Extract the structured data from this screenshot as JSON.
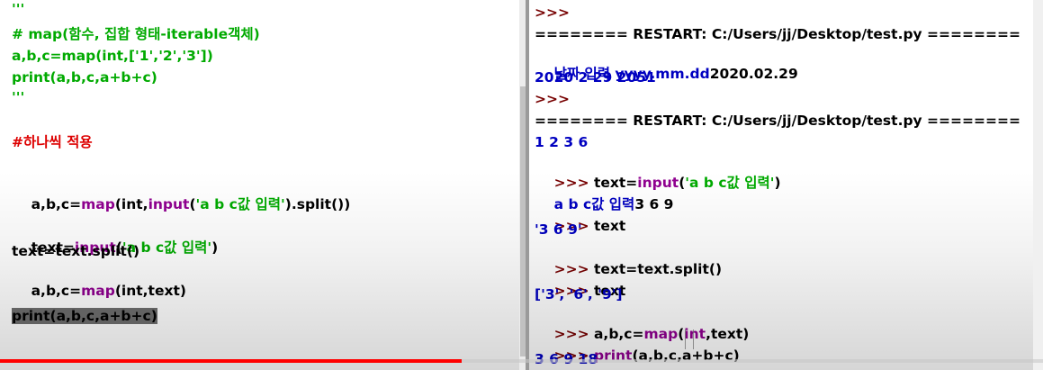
{
  "editor": {
    "lines": [
      {
        "text": "'''",
        "color": "green"
      },
      {
        "text": "# map(함수, 집합 형태-iterable객체)",
        "color": "green"
      },
      {
        "text": "a,b,c=map(int,['1','2','3'])",
        "color": "green"
      },
      {
        "text": "print(a,b,c,a+b+c)",
        "color": "green"
      },
      {
        "text": "'''",
        "color": "green"
      },
      {
        "text": "#하나씩 적용",
        "color": "red"
      },
      {
        "seg": [
          "a,b,c=",
          "map",
          "(int,",
          "input",
          "(",
          "'a b c값 입력'",
          ").split())"
        ]
      },
      {
        "seg": [
          "text=",
          "input",
          "(",
          "'a b c값 입력'",
          ")"
        ]
      },
      {
        "text": "text=text.split()",
        "color": "black"
      },
      {
        "seg": [
          "a,b,c=",
          "map",
          "(int,text)"
        ]
      },
      {
        "text": "print(a,b,c,a+b+c)",
        "color": "black",
        "highlight": true
      }
    ]
  },
  "shell": {
    "prompt": ">>>",
    "restart_line": "======== RESTART: C:/Users/jj/Desktop/test.py ========",
    "date_prompt": "날짜 입력 yyyy.mm.dd",
    "date_input": "2020.02.29",
    "date_output": "2020 2 29 2051",
    "output_1236": "1 2 3 6",
    "cmd_input_seg": [
      "text=",
      "input",
      "(",
      "'a b c값 입력'",
      ")"
    ],
    "input_prompt": "a b c값 입력",
    "input_value": "3 6 9",
    "cmd_text": "text",
    "text_value": "'3 6 9'",
    "cmd_split": "text=text.split()",
    "list_value": "['3', '6', '9']",
    "cmd_map_seg": [
      "a,b,c=",
      "map",
      "(",
      "int",
      ",text)"
    ],
    "cmd_print_seg": [
      "print",
      "(a,b,c,a+b+c)"
    ],
    "final_output": "3 6 9 18"
  },
  "video": {
    "progress_fraction": 0.443
  },
  "colors": {
    "comment_green": "#00aa00",
    "comment_red": "#dd0000",
    "builtin_purple": "#900090",
    "output_blue": "#0000c0",
    "prompt_maroon": "#770000"
  }
}
